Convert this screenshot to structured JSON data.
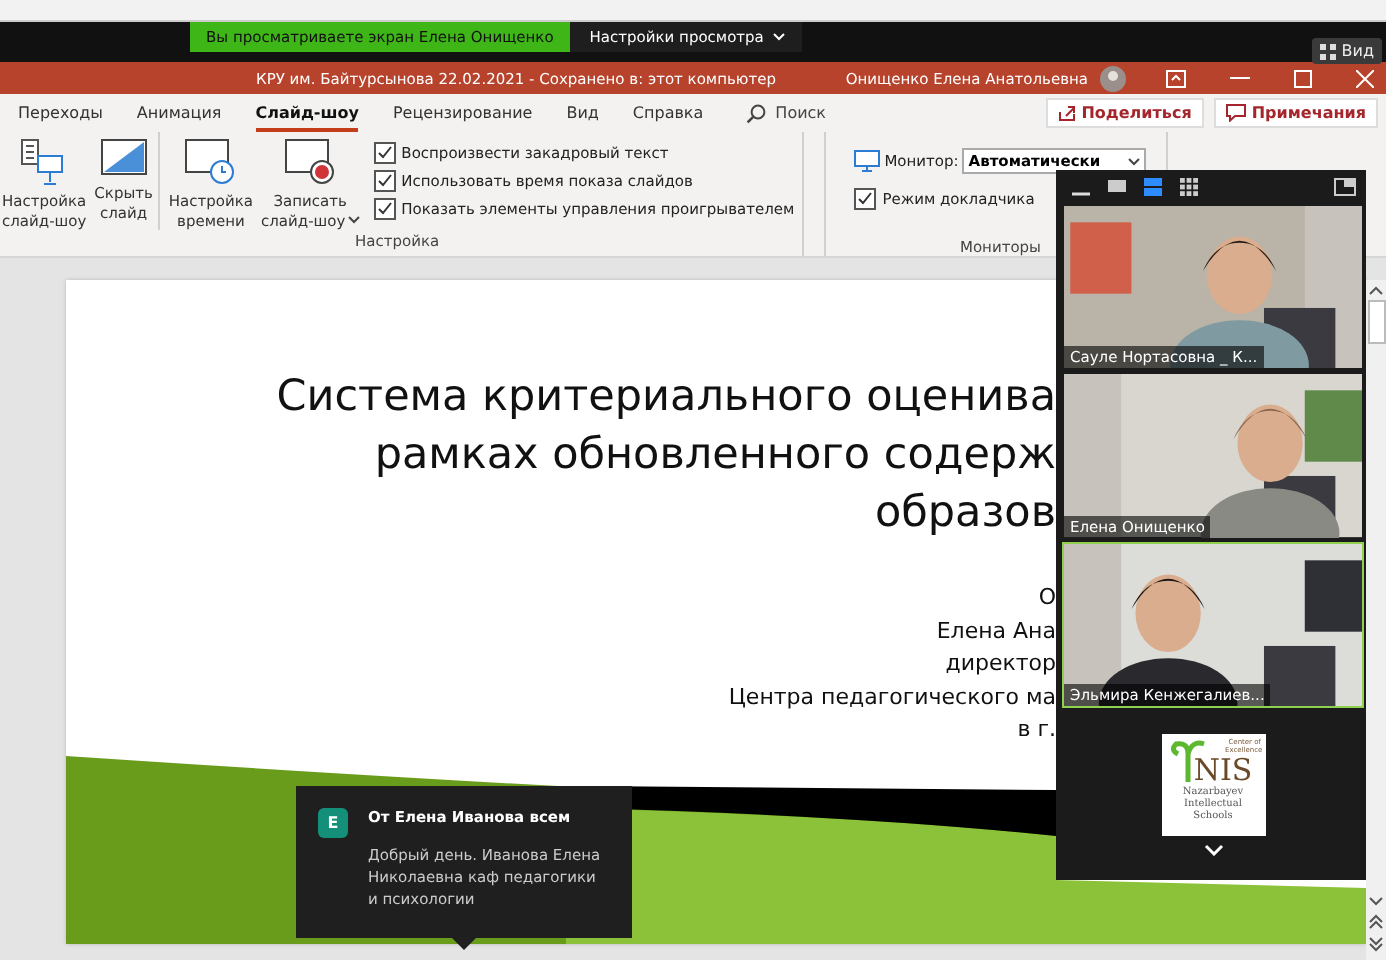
{
  "share_bar": {
    "banner": "Вы просматриваете экран Елена Онищенко",
    "view_options": "Настройки просмотра",
    "view_button": "Вид"
  },
  "title_bar": {
    "document": "КРУ им. Байтурсынова 22.02.2021  -  Сохранено в: этот компьютер",
    "user": "Онищенко Елена Анатольевна"
  },
  "ribbon_tabs": [
    {
      "label": "Переходы",
      "selected": false
    },
    {
      "label": "Анимация",
      "selected": false
    },
    {
      "label": "Слайд-шоу",
      "selected": true
    },
    {
      "label": "Рецензирование",
      "selected": false
    },
    {
      "label": "Вид",
      "selected": false
    },
    {
      "label": "Справка",
      "selected": false
    }
  ],
  "search": {
    "placeholder": "Поиск"
  },
  "actions": [
    {
      "label": "Поделиться",
      "kind": "share"
    },
    {
      "label": "Примечания",
      "kind": "comments"
    }
  ],
  "setup_group": {
    "label": "Настройка",
    "buttons": [
      {
        "lines": [
          "Настройка",
          "слайд-шоу"
        ],
        "kind": "setup",
        "dropdown": false
      },
      {
        "lines": [
          "Скрыть",
          "слайд"
        ],
        "kind": "hide",
        "dropdown": false
      },
      {
        "lines": [
          "Настройка",
          "времени"
        ],
        "kind": "timing",
        "dropdown": false
      },
      {
        "lines": [
          "Записать",
          "слайд-шоу"
        ],
        "kind": "record",
        "dropdown": true
      }
    ],
    "checkboxes": [
      {
        "label": "Воспроизвести закадровый текст",
        "checked": true
      },
      {
        "label": "Использовать время показа слайдов",
        "checked": true
      },
      {
        "label": "Показать элементы управления проигрывателем",
        "checked": true
      }
    ]
  },
  "monitors_group": {
    "label": "Мониторы",
    "monitor_label": "Монитор:",
    "monitor_value": "Автоматически",
    "checkboxes": [
      {
        "label": "Режим докладчика",
        "checked": true
      }
    ]
  },
  "slide": {
    "title_lines": [
      "Система критериального оценива",
      "рамках обновленного содерж",
      "образов"
    ],
    "subtitle_lines": [
      "О",
      "Елена Ана",
      "директор",
      "Центра педагогического ма",
      "в г."
    ]
  },
  "video_panel": {
    "view_modes": [
      {
        "kind": "speaker",
        "selected": true
      },
      {
        "kind": "gallery",
        "selected": false
      }
    ],
    "tiles": [
      {
        "kind": "video",
        "name": "Сауле Нортасовна _ К...",
        "selected": false
      },
      {
        "kind": "video",
        "name": "Елена Онищенко",
        "selected": false
      },
      {
        "kind": "video",
        "name": "Эльмира Кенжегалиев...",
        "selected": true
      },
      {
        "kind": "logo",
        "logo_texts": [
          "Center of Excellence",
          "NIS",
          "Nazarbayev Intellectual Schools"
        ],
        "selected": false
      }
    ]
  },
  "chat": {
    "avatar": "E",
    "header": "От Елена Иванова всем",
    "message": "Добрый день. Иванова Елена Николаевна каф педагогики и психологии"
  }
}
